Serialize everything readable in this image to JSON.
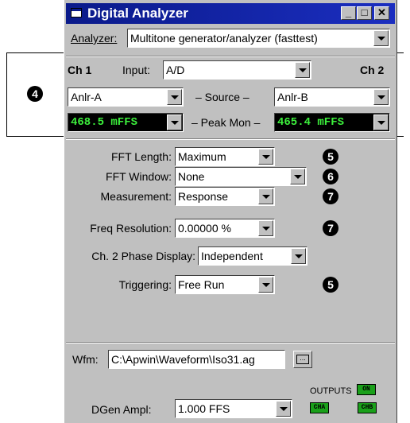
{
  "window": {
    "title": "Digital Analyzer",
    "min": "_",
    "max": "□",
    "close": "✕"
  },
  "analyzer": {
    "label": "Analyzer:",
    "value": "Multitone generator/analyzer (fasttest)"
  },
  "channels": {
    "ch1": "Ch 1",
    "ch2": "Ch 2",
    "input_label": "Input:",
    "input_value": "A/D",
    "source_label": "– Source –",
    "ch1_source": "Anlr-A",
    "ch2_source": "Anlr-B",
    "peak_label": "– Peak Mon –",
    "ch1_peak": "468.5  mFFS",
    "ch2_peak": "465.4  mFFS"
  },
  "settings": {
    "fft_length_label": "FFT Length:",
    "fft_length_value": "Maximum",
    "fft_window_label": "FFT Window:",
    "fft_window_value": "None",
    "measurement_label": "Measurement:",
    "measurement_value": "Response",
    "freq_res_label": "Freq Resolution:",
    "freq_res_value": "0.00000  %",
    "phase_label": "Ch. 2 Phase Display:",
    "phase_value": "Independent",
    "trigger_label": "Triggering:",
    "trigger_value": "Free Run"
  },
  "waveform": {
    "label": "Wfm:",
    "path": "C:\\Apwin\\Waveform\\Iso31.ag",
    "browse": "..."
  },
  "outputs": {
    "label": "OUTPUTS",
    "on": "ON",
    "cha": "CHA",
    "chb": "CHB"
  },
  "dgen": {
    "label": "DGen Ampl:",
    "value": "1.000   FFS"
  },
  "callouts": {
    "n4": "4",
    "n5a": "5",
    "n6": "6",
    "n7a": "7",
    "n7b": "7",
    "n5b": "5"
  }
}
